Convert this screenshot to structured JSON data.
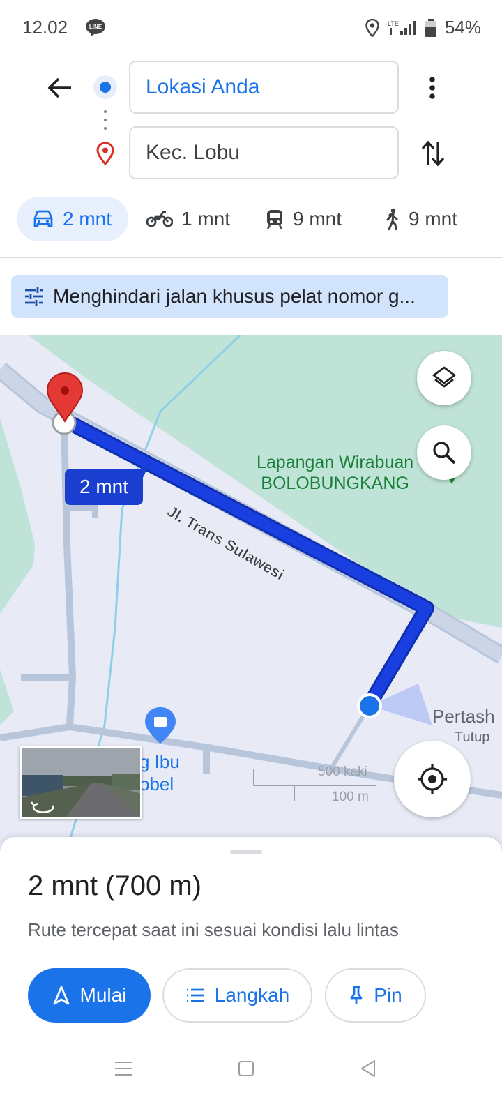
{
  "status_bar": {
    "time": "12.02",
    "battery": "54%",
    "network": "LTE",
    "icons": [
      "line-app-icon",
      "location-icon",
      "signal-icon",
      "battery-icon"
    ]
  },
  "directions": {
    "origin": "Lokasi Anda",
    "destination": "Kec. Lobu"
  },
  "modes": [
    {
      "name": "car",
      "icon": "car-icon",
      "time": "2 mnt",
      "selected": true
    },
    {
      "name": "motorcycle",
      "icon": "motorcycle-icon",
      "time": "1 mnt"
    },
    {
      "name": "transit",
      "icon": "train-icon",
      "time": "9 mnt"
    },
    {
      "name": "walk",
      "icon": "walk-icon",
      "time": "9 mnt"
    }
  ],
  "route_option": "Menghindari jalan khusus pelat nomor g...",
  "map": {
    "eta_label": "2 mnt",
    "road_name": "Jl. Trans Sulawesi",
    "place_line1": "Lapangan Wirabuan",
    "place_line2": "BOLOBUNGKANG",
    "shop_line1": "g Ibu",
    "shop_line2": "obel",
    "place_right": "Pertash",
    "place_right_status": "Tutup",
    "scale_feet": "500 kaki",
    "scale_meters": "100 m",
    "route_color": "#1a3fe0",
    "water_color": "#b9e4dc"
  },
  "sheet": {
    "summary": "2 mnt (700 m)",
    "subtitle": "Rute tercepat saat ini sesuai kondisi lalu lintas",
    "start_label": "Mulai",
    "steps_label": "Langkah",
    "pin_label": "Pin"
  }
}
